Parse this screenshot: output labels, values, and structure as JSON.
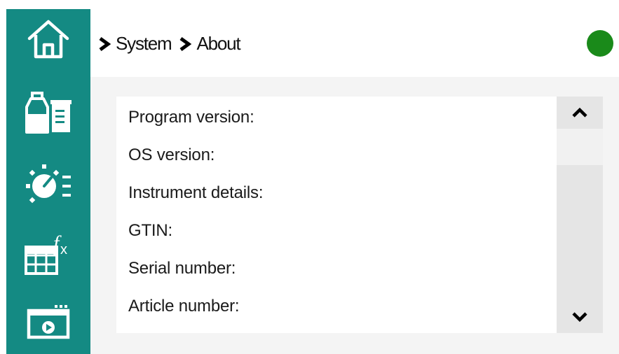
{
  "breadcrumb": {
    "items": [
      "System",
      "About"
    ]
  },
  "status": {
    "color": "#1a8a1a"
  },
  "sidebar": {
    "color": "#148a83",
    "items": [
      {
        "icon": "home-icon"
      },
      {
        "icon": "sample-containers-icon"
      },
      {
        "icon": "method-dial-icon"
      },
      {
        "icon": "table-formula-icon"
      },
      {
        "icon": "video-window-icon"
      }
    ]
  },
  "about": {
    "rows": [
      {
        "label": "Program version:"
      },
      {
        "label": "OS version:"
      },
      {
        "label": "Instrument details:"
      },
      {
        "label": "GTIN:"
      },
      {
        "label": "Serial number:"
      },
      {
        "label": "Article number:"
      }
    ]
  }
}
